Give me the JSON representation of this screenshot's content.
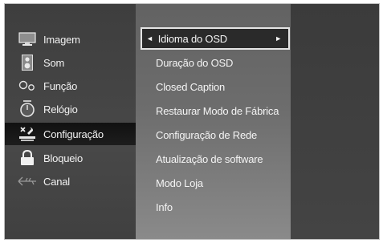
{
  "main_menu": {
    "items": [
      {
        "label": "Imagem",
        "icon": "monitor-icon"
      },
      {
        "label": "Som",
        "icon": "speaker-icon"
      },
      {
        "label": "Função",
        "icon": "function-icon"
      },
      {
        "label": "Relógio",
        "icon": "clock-icon"
      },
      {
        "label": "Configuração",
        "icon": "tools-icon"
      },
      {
        "label": "Bloqueio",
        "icon": "lock-icon"
      },
      {
        "label": "Canal",
        "icon": "antenna-icon"
      }
    ],
    "active_index": 4
  },
  "sub_menu": {
    "items": [
      {
        "label": "Idioma do OSD"
      },
      {
        "label": "Duração do OSD"
      },
      {
        "label": "Closed Caption"
      },
      {
        "label": "Restaurar Modo de Fábrica"
      },
      {
        "label": "Configuração de Rede"
      },
      {
        "label": "Atualização de software"
      },
      {
        "label": "Modo Loja"
      },
      {
        "label": "Info"
      }
    ],
    "selected_index": 0,
    "arrow_left": "◄",
    "arrow_right": "►"
  },
  "colors": {
    "background": "#3f3f3f",
    "submenu_background": "#6d6d6d",
    "selected_border": "#e4e4e4",
    "text": "#f1f1f1"
  }
}
